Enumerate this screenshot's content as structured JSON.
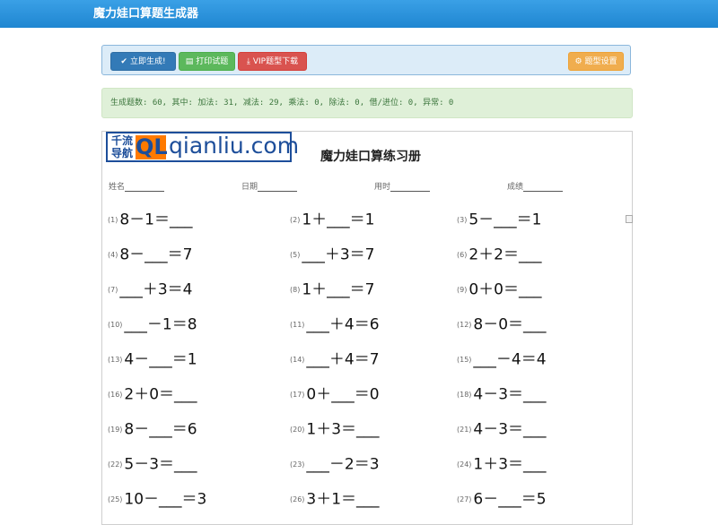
{
  "header": {
    "title": "魔力娃口算题生成器"
  },
  "toolbar": {
    "generate": {
      "icon": "check-icon",
      "label": "立即生成!"
    },
    "print": {
      "icon": "print-icon",
      "label": "打印试题"
    },
    "vip": {
      "icon": "download-icon",
      "label": "VIP题型下载"
    },
    "settings": {
      "icon": "gear-icon",
      "label": "题型设置"
    }
  },
  "info": {
    "text": "生成题数: 60, 其中: 加法: 31, 减法: 29, 乘法: 0, 除法: 0, 借/进位: 0, 异常: 0"
  },
  "logo": {
    "cn": "千流导航",
    "mark": "QL",
    "domain": "qianliu.com"
  },
  "sheet": {
    "title": "魔力娃口算练习册",
    "fields": [
      "姓名",
      "日期",
      "用时",
      "成绩"
    ]
  },
  "problems": [
    {
      "num": "(1)",
      "expr": "8－1＝___"
    },
    {
      "num": "(2)",
      "expr": "1＋___＝1"
    },
    {
      "num": "(3)",
      "expr": "5－___＝1"
    },
    {
      "num": "(4)",
      "expr": "8－___＝7"
    },
    {
      "num": "(5)",
      "expr": "___＋3＝7"
    },
    {
      "num": "(6)",
      "expr": "2＋2＝___"
    },
    {
      "num": "(7)",
      "expr": "___＋3＝4"
    },
    {
      "num": "(8)",
      "expr": "1＋___＝7"
    },
    {
      "num": "(9)",
      "expr": "0＋0＝___"
    },
    {
      "num": "(10)",
      "expr": "___－1＝8"
    },
    {
      "num": "(11)",
      "expr": "___＋4＝6"
    },
    {
      "num": "(12)",
      "expr": "8－0＝___"
    },
    {
      "num": "(13)",
      "expr": "4－___＝1"
    },
    {
      "num": "(14)",
      "expr": "___＋4＝7"
    },
    {
      "num": "(15)",
      "expr": "___－4＝4"
    },
    {
      "num": "(16)",
      "expr": "2＋0＝___"
    },
    {
      "num": "(17)",
      "expr": "0＋___＝0"
    },
    {
      "num": "(18)",
      "expr": "4－3＝___"
    },
    {
      "num": "(19)",
      "expr": "8－___＝6"
    },
    {
      "num": "(20)",
      "expr": "1＋3＝___"
    },
    {
      "num": "(21)",
      "expr": "4－3＝___"
    },
    {
      "num": "(22)",
      "expr": "5－3＝___"
    },
    {
      "num": "(23)",
      "expr": "___－2＝3"
    },
    {
      "num": "(24)",
      "expr": "1＋3＝___"
    },
    {
      "num": "(25)",
      "expr": "10－___＝3"
    },
    {
      "num": "(26)",
      "expr": "3＋1＝___"
    },
    {
      "num": "(27)",
      "expr": "6－___＝5"
    }
  ]
}
